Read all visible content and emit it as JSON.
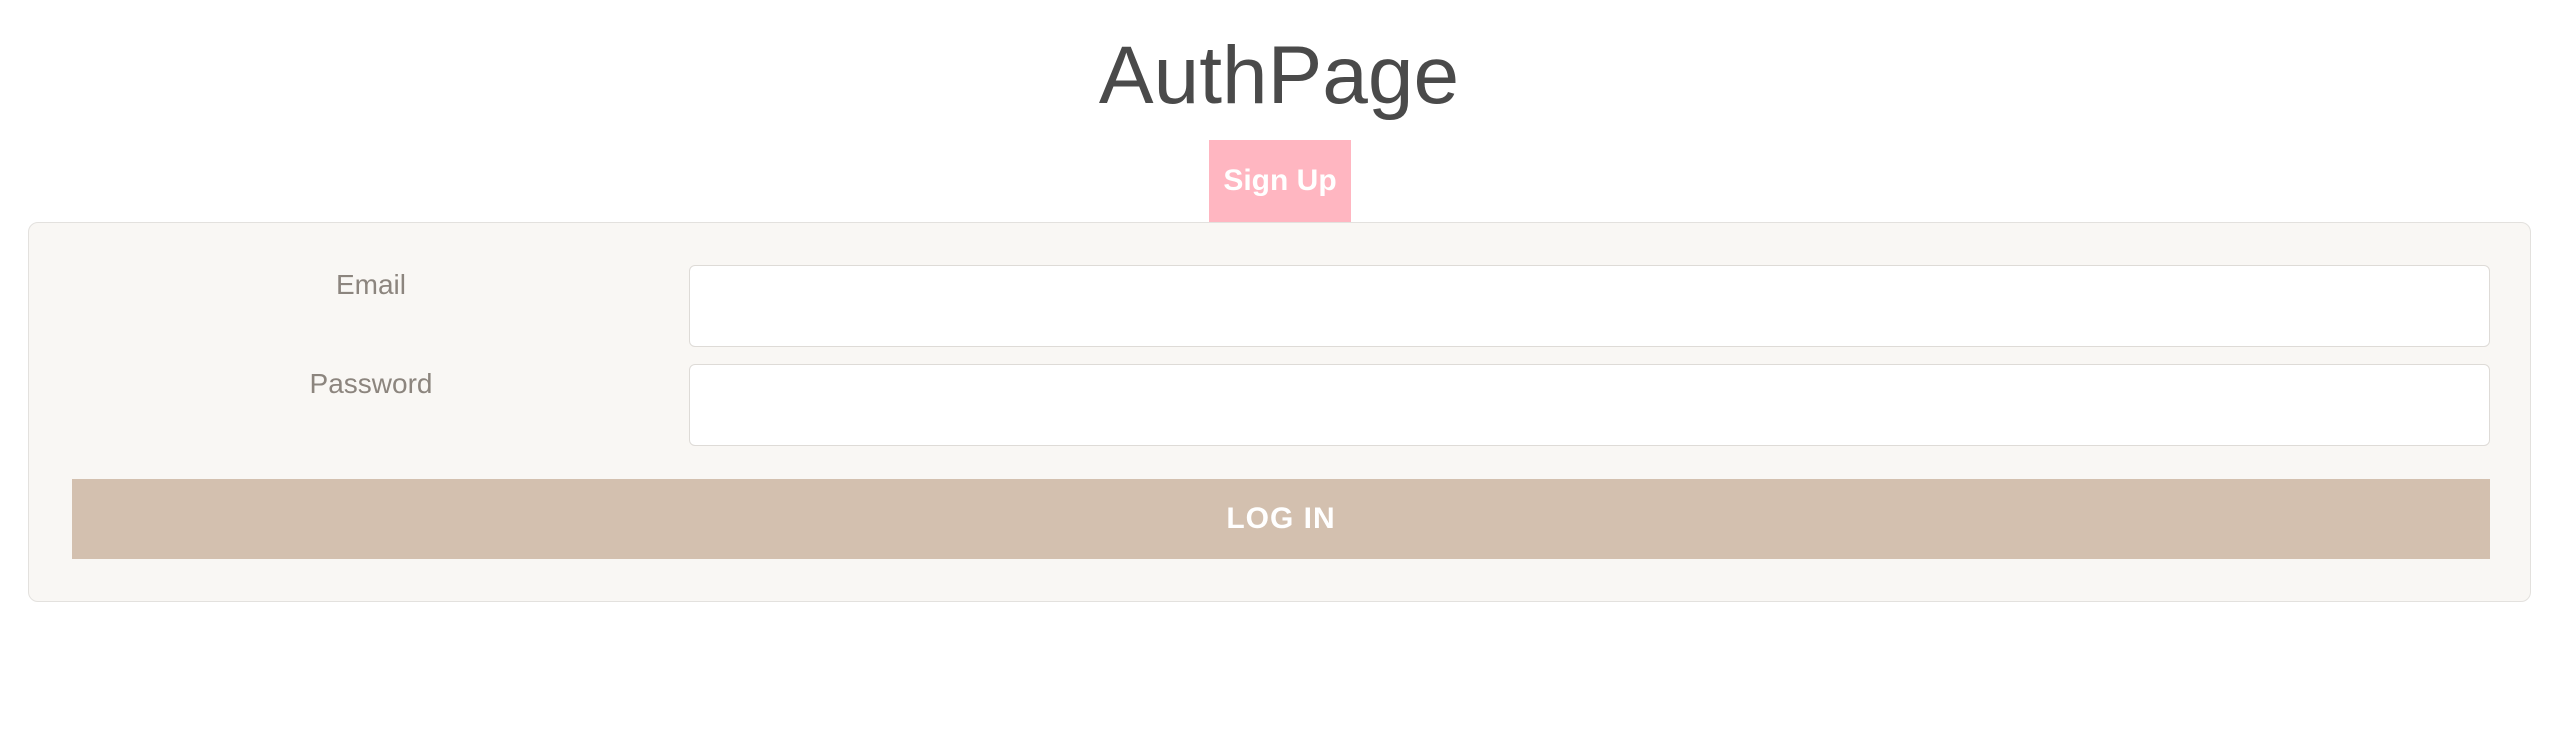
{
  "header": {
    "title": "AuthPage"
  },
  "tabs": {
    "signup_label": "Sign Up"
  },
  "form": {
    "email": {
      "label": "Email",
      "value": "",
      "placeholder": ""
    },
    "password": {
      "label": "Password",
      "value": "",
      "placeholder": ""
    },
    "submit_label": "LOG IN"
  },
  "colors": {
    "title_text": "#4a4a4a",
    "signup_tab_bg": "#ffb6c1",
    "panel_bg": "#f9f7f4",
    "label_text": "#8c857e",
    "login_button_bg": "#d3c0af"
  }
}
